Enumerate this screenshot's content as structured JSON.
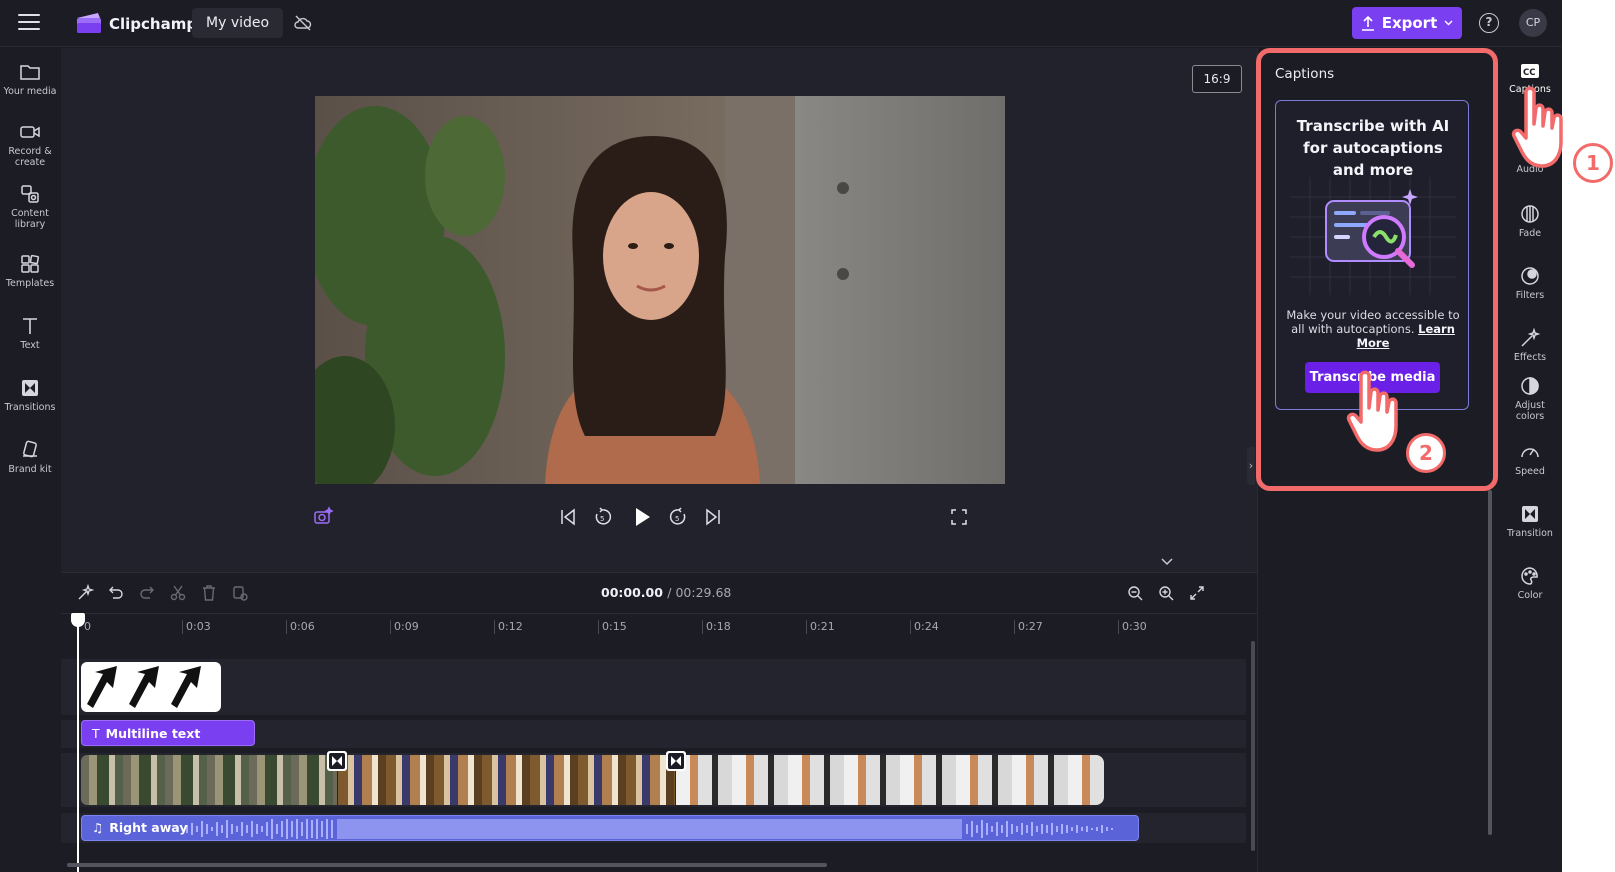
{
  "header": {
    "app_name": "Clipchamp",
    "project_name": "My video",
    "export_label": "Export",
    "help_glyph": "?",
    "avatar_initials": "CP",
    "accent_color": "#7b3ff2"
  },
  "left_nav": [
    {
      "label": "Your media",
      "icon": "folder-icon"
    },
    {
      "label": "Record & create",
      "icon": "camera-icon"
    },
    {
      "label": "Content library",
      "icon": "library-icon"
    },
    {
      "label": "Templates",
      "icon": "templates-icon"
    },
    {
      "label": "Text",
      "icon": "text-icon"
    },
    {
      "label": "Transitions",
      "icon": "transitions-icon"
    },
    {
      "label": "Brand kit",
      "icon": "brand-kit-icon"
    }
  ],
  "preview": {
    "aspect_ratio": "16:9"
  },
  "timeline": {
    "current_time": "00:00.00",
    "total_time": "/ 00:29.68",
    "ruler_ticks": [
      "0",
      "0:03",
      "0:06",
      "0:09",
      "0:12",
      "0:15",
      "0:18",
      "0:21",
      "0:24",
      "0:27",
      "0:30"
    ],
    "text_clip_label": "Multiline text",
    "audio_clip_label": "Right away"
  },
  "captions_panel": {
    "title": "Captions",
    "promo_title": "Transcribe with AI for autocaptions and more",
    "promo_description": "Make your video accessible to all with autocaptions.",
    "learn_more_label": "Learn More",
    "transcribe_button_label": "Transcribe media"
  },
  "right_nav": [
    {
      "label": "Captions",
      "icon": "cc-icon",
      "active": true
    },
    {
      "label": "Audio",
      "icon": "audio-icon"
    },
    {
      "label": "Fade",
      "icon": "fade-icon"
    },
    {
      "label": "Filters",
      "icon": "filters-icon"
    },
    {
      "label": "Effects",
      "icon": "effects-icon"
    },
    {
      "label": "Adjust colors",
      "icon": "adjust-colors-icon"
    },
    {
      "label": "Speed",
      "icon": "speed-icon"
    },
    {
      "label": "Transition",
      "icon": "transition-icon"
    },
    {
      "label": "Color",
      "icon": "palette-icon"
    }
  ],
  "annotations": {
    "step_1": "1",
    "step_2": "2",
    "highlight_color": "#f26a6a"
  }
}
